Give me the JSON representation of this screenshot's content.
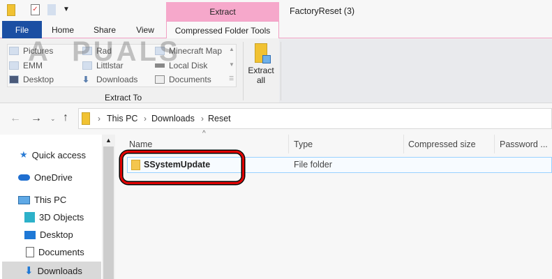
{
  "window": {
    "title": "FactoryReset (3)",
    "contextual_tab_group": "Extract"
  },
  "watermark": "APPUALS",
  "tabs": [
    "File",
    "Home",
    "Share",
    "View",
    "Compressed Folder Tools"
  ],
  "ribbon": {
    "extract_to_items": [
      "Pictures",
      "Rad",
      "Minecraft Map",
      "EMM",
      "Littlstar",
      "Local Disk",
      "Desktop",
      "Downloads",
      "Documents"
    ],
    "group_label": "Extract To",
    "extract_all_label": "Extract all"
  },
  "address": {
    "breadcrumbs": [
      "This PC",
      "Downloads",
      "Reset"
    ]
  },
  "nav": {
    "items": [
      "Quick access",
      "OneDrive",
      "This PC",
      "3D Objects",
      "Desktop",
      "Documents",
      "Downloads"
    ],
    "selected": "Downloads"
  },
  "columns": [
    "Name",
    "Type",
    "Compressed size",
    "Password ..."
  ],
  "files": [
    {
      "name": "SSystemUpdate",
      "type": "File folder"
    }
  ],
  "colors": {
    "file_tab": "#1b4fa3",
    "context_tab": "#f6a8cb",
    "highlight": "#e30000",
    "selection": "#99d1ff"
  }
}
